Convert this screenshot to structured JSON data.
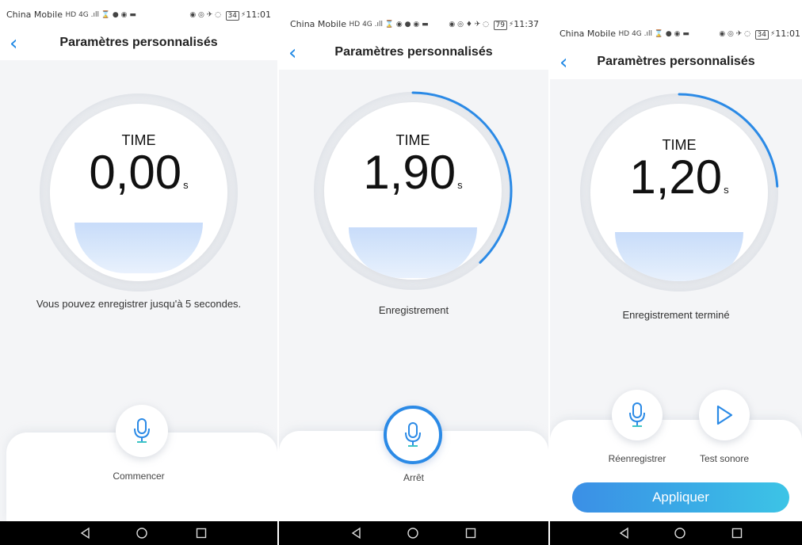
{
  "screens": [
    {
      "status": {
        "carrier": "China Mobile",
        "indicators": "HD 4G .ıll ⌛ ● ◉ ▬",
        "right_indicators": "◉ ◎ ✈ ◌",
        "battery": "34",
        "time": "11:01"
      },
      "header": {
        "back_icon": "chevron-left-icon",
        "title": "Paramètres personnalisés"
      },
      "timer": {
        "label": "TIME",
        "value": "0,00",
        "unit": "s",
        "progress": 0
      },
      "caption": "Vous pouvez enregistrer jusqu'à 5 secondes.",
      "buttons": [
        {
          "icon": "microphone-icon",
          "label": "Commencer"
        }
      ]
    },
    {
      "status": {
        "carrier": "China Mobile",
        "indicators": "HD 4G .ıll ⌛ ◉ ● ◉ ▬",
        "right_indicators": "◉ ◎ ♦ ✈ ◌",
        "battery": "79",
        "time": "11:37"
      },
      "header": {
        "back_icon": "chevron-left-icon",
        "title": "Paramètres personnalisés"
      },
      "timer": {
        "label": "TIME",
        "value": "1,90",
        "unit": "s",
        "progress": 0.38
      },
      "caption": "Enregistrement",
      "buttons": [
        {
          "icon": "microphone-icon",
          "label": "Arrêt"
        }
      ]
    },
    {
      "status": {
        "carrier": "China Mobile",
        "indicators": "HD 4G .ıll ⌛ ● ◉ ▬",
        "right_indicators": "◉ ◎ ✈ ◌",
        "battery": "34",
        "time": "11:01"
      },
      "header": {
        "back_icon": "chevron-left-icon",
        "title": "Paramètres personnalisés"
      },
      "timer": {
        "label": "TIME",
        "value": "1,20",
        "unit": "s",
        "progress": 0.24
      },
      "caption": "Enregistrement terminé",
      "buttons": [
        {
          "icon": "microphone-icon",
          "label": "Réenregistrer"
        },
        {
          "icon": "play-icon",
          "label": "Test sonore"
        }
      ],
      "apply_label": "Appliquer"
    }
  ],
  "navbar": {
    "back": "back-triangle-icon",
    "home": "home-circle-icon",
    "recent": "recent-square-icon"
  },
  "colors": {
    "accent": "#2b8ae6",
    "background": "#f4f5f7",
    "navbar": "#000000"
  }
}
